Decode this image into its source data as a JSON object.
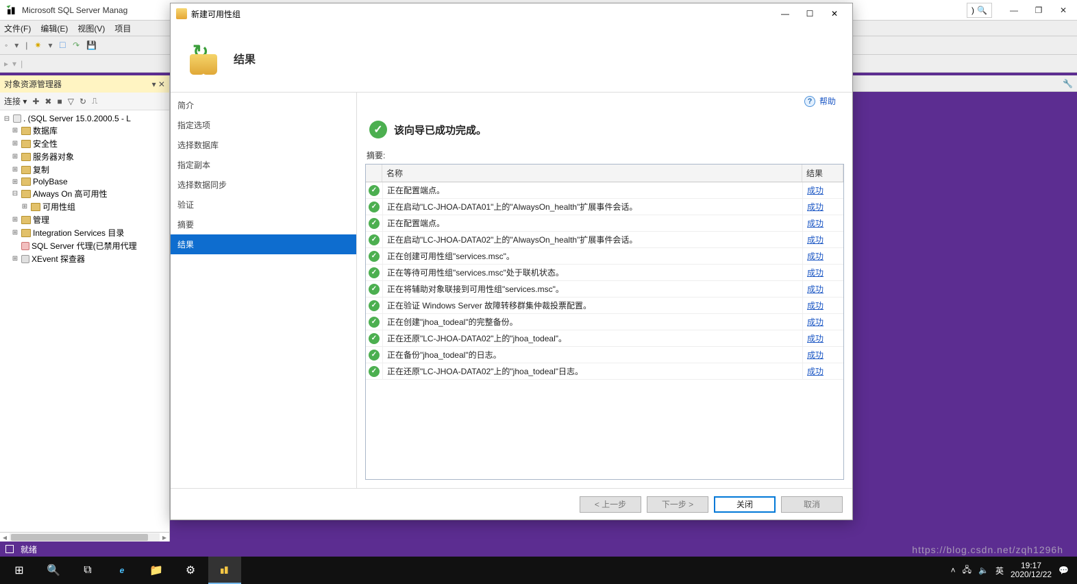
{
  "titleBar": {
    "appTitle": "Microsoft SQL Server Manag",
    "searchPlaceholder": ")"
  },
  "menu": {
    "file": "文件(F)",
    "edit": "编辑(E)",
    "view": "视图(V)",
    "project": "项目"
  },
  "panel": {
    "title": "对象资源管理器",
    "connectLabel": "连接 ▾",
    "server": ". (SQL Server 15.0.2000.5 - L",
    "nodes": {
      "databases": "数据库",
      "security": "安全性",
      "serverObjects": "服务器对象",
      "replication": "复制",
      "polybase": "PolyBase",
      "alwaysOn": "Always On 高可用性",
      "availabilityGroups": "可用性组",
      "management": "管理",
      "integration": "Integration Services 目录",
      "agent": "SQL Server 代理(已禁用代理",
      "xevent": "XEvent 探查器"
    }
  },
  "dialog": {
    "title": "新建可用性组",
    "headerTitle": "结果",
    "help": "帮助",
    "nav": {
      "intro": "简介",
      "options": "指定选项",
      "selectDb": "选择数据库",
      "replica": "指定副本",
      "dataSync": "选择数据同步",
      "validate": "验证",
      "summary": "摘要",
      "results": "结果"
    },
    "successMsg": "该向导已成功完成。",
    "summaryLabel": "摘要:",
    "gridHeader": {
      "name": "名称",
      "result": "结果"
    },
    "successLink": "成功",
    "rows": [
      "正在配置端点。",
      "正在启动\"LC-JHOA-DATA01\"上的\"AlwaysOn_health\"扩展事件会话。",
      "正在配置端点。",
      "正在启动\"LC-JHOA-DATA02\"上的\"AlwaysOn_health\"扩展事件会话。",
      "正在创建可用性组\"services.msc\"。",
      "正在等待可用性组\"services.msc\"处于联机状态。",
      "正在将辅助对象联接到可用性组\"services.msc\"。",
      "正在验证 Windows Server 故障转移群集仲裁投票配置。",
      "正在创建\"jhoa_todeal\"的完整备份。",
      "正在还原\"LC-JHOA-DATA02\"上的\"jhoa_todeal\"。",
      "正在备份\"jhoa_todeal\"的日志。",
      "正在还原\"LC-JHOA-DATA02\"上的\"jhoa_todeal\"日志。"
    ],
    "buttons": {
      "prev": "< 上一步",
      "next": "下一步 >",
      "close": "关闭",
      "cancel": "取消"
    }
  },
  "statusBar": {
    "ready": "就绪"
  },
  "taskBar": {
    "time": "19:17",
    "date": "2020/12/22",
    "ime": "英"
  },
  "watermark": "https://blog.csdn.net/zqh1296h"
}
